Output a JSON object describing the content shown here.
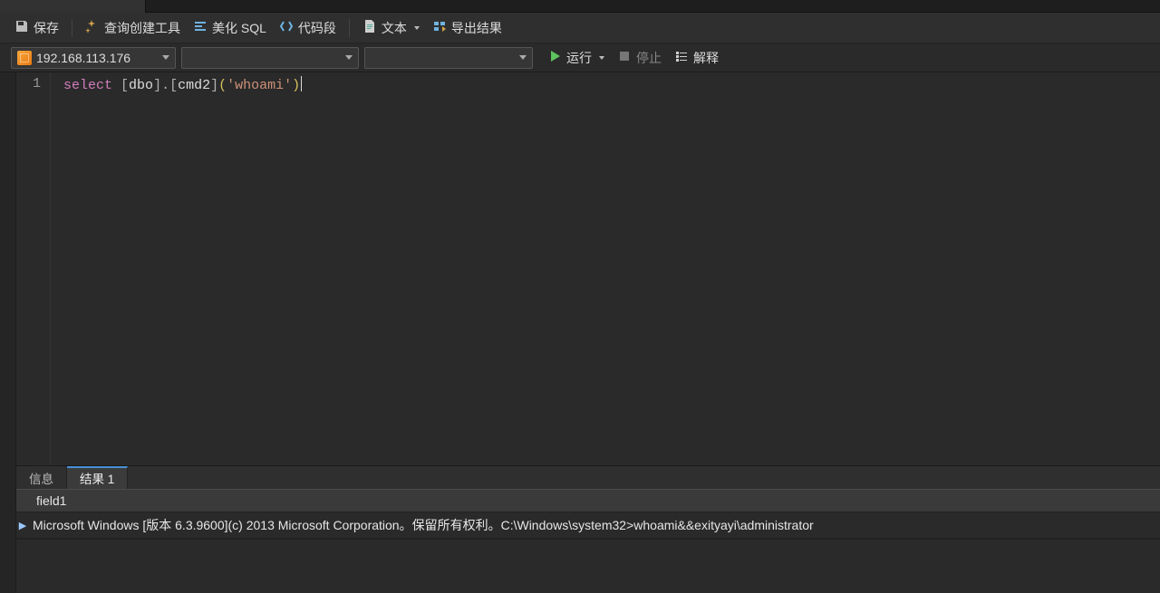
{
  "toolbar": {
    "save": "保存",
    "query_builder": "查询创建工具",
    "beautify_sql": "美化 SQL",
    "snippet": "代码段",
    "text": "文本",
    "export": "导出结果"
  },
  "runbar": {
    "server": "192.168.113.176",
    "database": "",
    "schema": "",
    "run": "运行",
    "stop": "停止",
    "explain": "解释"
  },
  "editor": {
    "line_no": "1",
    "kw_select": "select",
    "seg_dbo": "dbo",
    "seg_cmd": "cmd2",
    "string": "'whoami'"
  },
  "result_tabs": {
    "info": "信息",
    "result1": "结果 1"
  },
  "grid": {
    "column": "field1",
    "row1": "Microsoft Windows [版本 6.3.9600](c) 2013 Microsoft Corporation。保留所有权利。C:\\Windows\\system32>whoami&&exityayi\\administrator"
  }
}
